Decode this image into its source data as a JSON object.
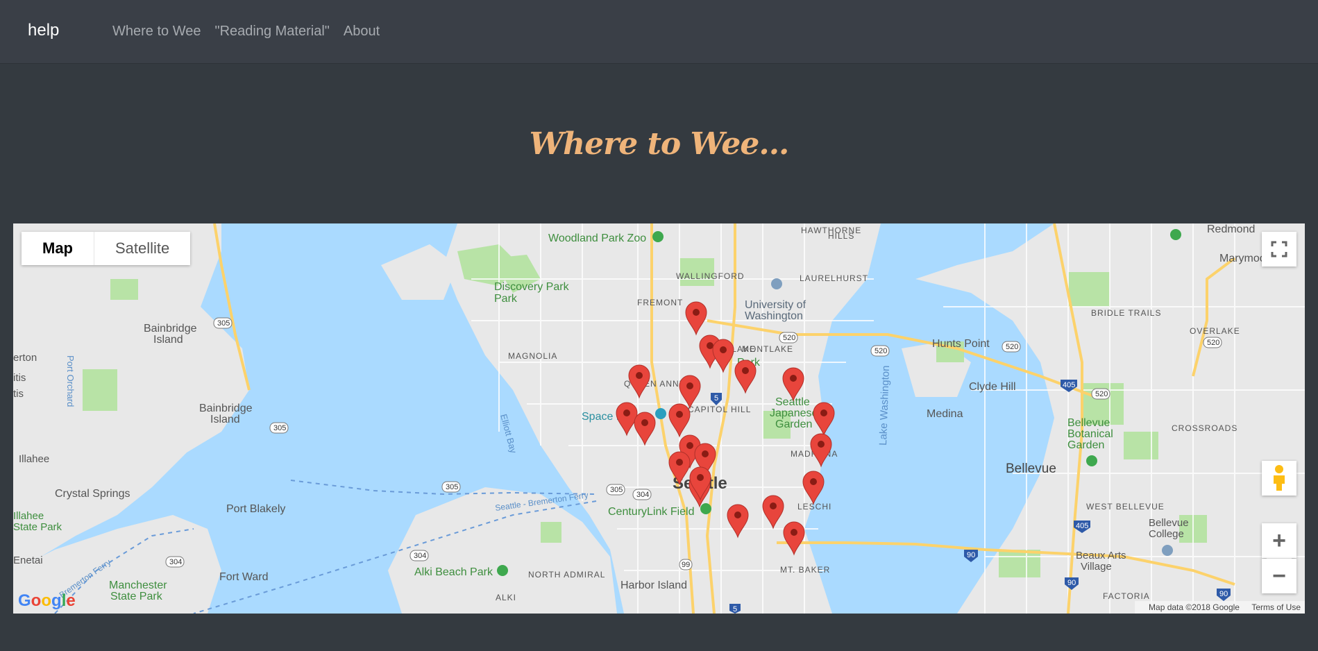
{
  "navbar": {
    "brand": "help",
    "links": [
      "Where to Wee",
      "\"Reading Material\"",
      "About"
    ]
  },
  "heading": "Where to Wee...",
  "map": {
    "type_control": {
      "map_label": "Map",
      "satellite_label": "Satellite",
      "selected": "Map"
    },
    "attribution": {
      "data": "Map data ©2018 Google",
      "terms": "Terms of Use"
    },
    "logo": "Google",
    "icons": {
      "fullscreen": "fullscreen-icon",
      "pegman": "pegman-icon",
      "zoom_in": "plus-icon",
      "zoom_out": "minus-icon"
    },
    "colors": {
      "water": "#aadaff",
      "land": "#e8e8e8",
      "park": "#b8e3a6",
      "road": "#ffe18a",
      "marker": "#e8453c",
      "marker_dot": "#8a1c14"
    },
    "labels": {
      "city": [
        "Seattle",
        "Bellevue"
      ],
      "places": [
        "Woodland Park Zoo",
        "Discovery Park",
        "University of Washington",
        "Seattle Japanese Garden",
        "Space Needle",
        "CenturyLink Field",
        "Alki Beach Park",
        "Bellevue Botanical Garden",
        "Bellevue College",
        "Beaux Arts Village",
        "Harbor Island",
        "Manchester State Park",
        "Illahee State Park",
        "Fort Ward",
        "Port Blakely",
        "Crystal Springs",
        "Bainbridge Island",
        "Clyde Hill",
        "Medina",
        "Hunts Point",
        "Redmond",
        "Marymoor",
        "Madrona",
        "Leschi",
        "Mt. Baker",
        "Fremont",
        "Wallingford",
        "Laurelhurst",
        "Hawthorne Hills",
        "Queen Anne",
        "Capitol Hill",
        "Eastlake",
        "Montlake",
        "Magnolia",
        "North Admiral",
        "Alki",
        "Bridle Trails",
        "Overlake",
        "Crossroads",
        "West Bellevue",
        "Factoria",
        "Volunteer Park",
        "Illahee",
        "Enetai",
        "Port Orchard",
        "Elliott Bay",
        "Lake Washington",
        "Seattle - Bremerton Ferry",
        "Bremerton Ferry",
        "Bainbridge Island",
        "erton",
        "tis"
      ],
      "shields": [
        "305",
        "304",
        "520",
        "405",
        "90",
        "5",
        "99"
      ]
    },
    "markers_count": 21
  }
}
